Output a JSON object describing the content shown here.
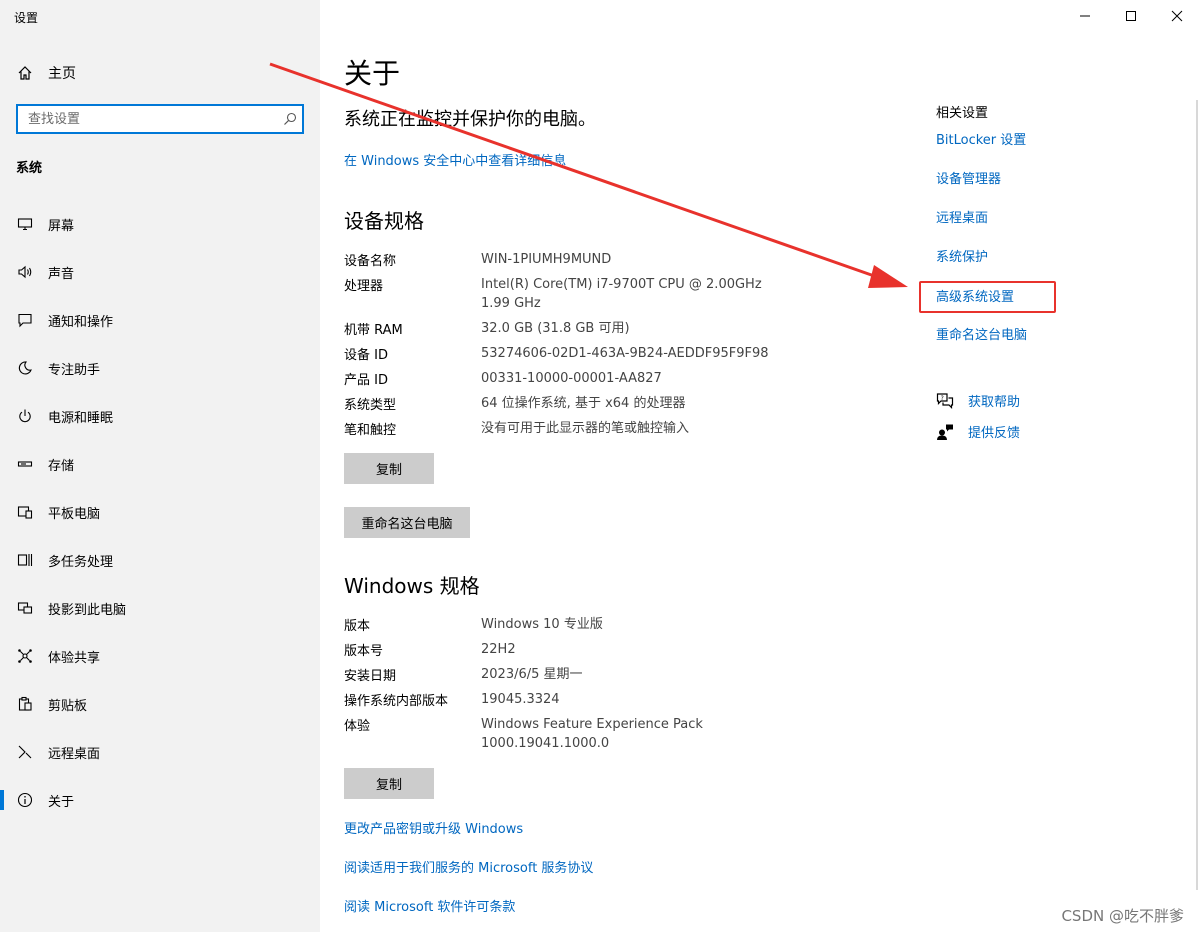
{
  "window": {
    "title": "设置"
  },
  "sidebar": {
    "home": "主页",
    "search_placeholder": "查找设置",
    "section": "系统",
    "items": [
      {
        "label": "屏幕",
        "icon": "monitor-icon"
      },
      {
        "label": "声音",
        "icon": "speaker-icon"
      },
      {
        "label": "通知和操作",
        "icon": "notification-icon"
      },
      {
        "label": "专注助手",
        "icon": "moon-icon"
      },
      {
        "label": "电源和睡眠",
        "icon": "power-icon"
      },
      {
        "label": "存储",
        "icon": "storage-icon"
      },
      {
        "label": "平板电脑",
        "icon": "tablet-icon"
      },
      {
        "label": "多任务处理",
        "icon": "multitask-icon"
      },
      {
        "label": "投影到此电脑",
        "icon": "project-icon"
      },
      {
        "label": "体验共享",
        "icon": "share-icon"
      },
      {
        "label": "剪贴板",
        "icon": "clipboard-icon"
      },
      {
        "label": "远程桌面",
        "icon": "remote-desktop-icon"
      },
      {
        "label": "关于",
        "icon": "info-icon"
      }
    ],
    "selected_index": 12
  },
  "main": {
    "title": "关于",
    "protect_text": "系统正在监控并保护你的电脑。",
    "security_link": "在 Windows 安全中心中查看详细信息",
    "device_heading": "设备规格",
    "device_specs": [
      {
        "key": "设备名称",
        "value": "WIN-1PIUMH9MUND"
      },
      {
        "key": "处理器",
        "value": "Intel(R) Core(TM) i7-9700T CPU @ 2.00GHz   1.99 GHz"
      },
      {
        "key": "机带 RAM",
        "value": "32.0 GB (31.8 GB 可用)"
      },
      {
        "key": "设备 ID",
        "value": "53274606-02D1-463A-9B24-AEDDF95F9F98"
      },
      {
        "key": "产品 ID",
        "value": "00331-10000-00001-AA827"
      },
      {
        "key": "系统类型",
        "value": "64 位操作系统, 基于 x64 的处理器"
      },
      {
        "key": "笔和触控",
        "value": "没有可用于此显示器的笔或触控输入"
      }
    ],
    "copy_button": "复制",
    "rename_button": "重命名这台电脑",
    "windows_heading": "Windows 规格",
    "windows_specs": [
      {
        "key": "版本",
        "value": "Windows 10 专业版"
      },
      {
        "key": "版本号",
        "value": "22H2"
      },
      {
        "key": "安装日期",
        "value": "2023/6/5 星期一"
      },
      {
        "key": "操作系统内部版本",
        "value": "19045.3324"
      },
      {
        "key": "体验",
        "value": "Windows Feature Experience Pack 1000.19041.1000.0"
      }
    ],
    "copy_button_2": "复制",
    "links": [
      "更改产品密钥或升级 Windows",
      "阅读适用于我们服务的 Microsoft 服务协议",
      "阅读 Microsoft 软件许可条款"
    ]
  },
  "related": {
    "heading": "相关设置",
    "links": [
      "BitLocker 设置",
      "设备管理器",
      "远程桌面",
      "系统保护",
      "高级系统设置",
      "重命名这台电脑"
    ],
    "highlighted_index": 4,
    "help": {
      "label": "获取帮助",
      "icon": "help-chat-icon"
    },
    "feedback": {
      "label": "提供反馈",
      "icon": "feedback-icon"
    }
  },
  "watermark": "CSDN @吃不胖爹",
  "colors": {
    "accent": "#0078d7",
    "link": "#0067c0",
    "highlight_box": "#e8322c",
    "annotation_arrow": "#e8322c",
    "sidebar_bg": "#f2f2f2",
    "button_bg": "#cccccc"
  }
}
